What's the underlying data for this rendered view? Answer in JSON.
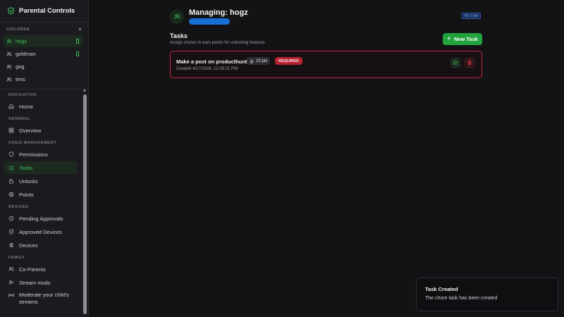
{
  "sidebar": {
    "brand_title": "Parental Controls",
    "children_header": "CHILDREN",
    "add_child_symbol": "+",
    "children": [
      {
        "name": "hogz",
        "active": true,
        "device_icon": true
      },
      {
        "name": "goldman",
        "active": false,
        "device_icon": true
      },
      {
        "name": "gog",
        "active": false,
        "device_icon": false
      },
      {
        "name": "tims",
        "active": false,
        "device_icon": false
      }
    ],
    "sections": [
      {
        "label": "NAVIGATION",
        "items": [
          {
            "label": "Home",
            "icon": "home-icon"
          }
        ]
      },
      {
        "label": "GENERAL",
        "items": [
          {
            "label": "Overview",
            "icon": "grid-icon"
          }
        ]
      },
      {
        "label": "CHILD MANAGEMENT",
        "items": [
          {
            "label": "Permissions",
            "icon": "shield-icon"
          },
          {
            "label": "Tasks",
            "icon": "list-check-icon",
            "active": true
          },
          {
            "label": "Unlocks",
            "icon": "lock-open-icon"
          },
          {
            "label": "Points",
            "icon": "coin-icon"
          }
        ]
      },
      {
        "label": "DEVICES",
        "items": [
          {
            "label": "Pending Approvals",
            "icon": "clock-icon"
          },
          {
            "label": "Approved Devices",
            "icon": "shield-check-icon"
          },
          {
            "label": "Devices",
            "icon": "sliders-icon"
          }
        ]
      },
      {
        "label": "FAMILY",
        "items": [
          {
            "label": "Co-Parents",
            "icon": "users-icon"
          },
          {
            "label": "Stream mods",
            "icon": "user-plus-icon"
          },
          {
            "label": "Moderate your child's streams",
            "icon": "broadcast-icon"
          }
        ]
      }
    ]
  },
  "header": {
    "title": "Managing: hogz",
    "badge": "My Child"
  },
  "tasks": {
    "title": "Tasks",
    "subtitle": "Assign chores to earn points for unlocking features",
    "new_task_label": "New Task",
    "items": [
      {
        "name": "Make a post on producthunt",
        "points": "10 pts",
        "badge": "REQUIRED",
        "created": "Created 4/17/2026, 12:36:21 PM"
      }
    ]
  },
  "toast": {
    "title": "Task Created",
    "message": "The chore task has been created"
  },
  "colors": {
    "accent_green": "#22a33c",
    "active_green_text": "#3ec45a",
    "danger_red": "#c4263a",
    "badge_blue": "#6ea6ff",
    "redaction_blue": "#1670d8"
  }
}
